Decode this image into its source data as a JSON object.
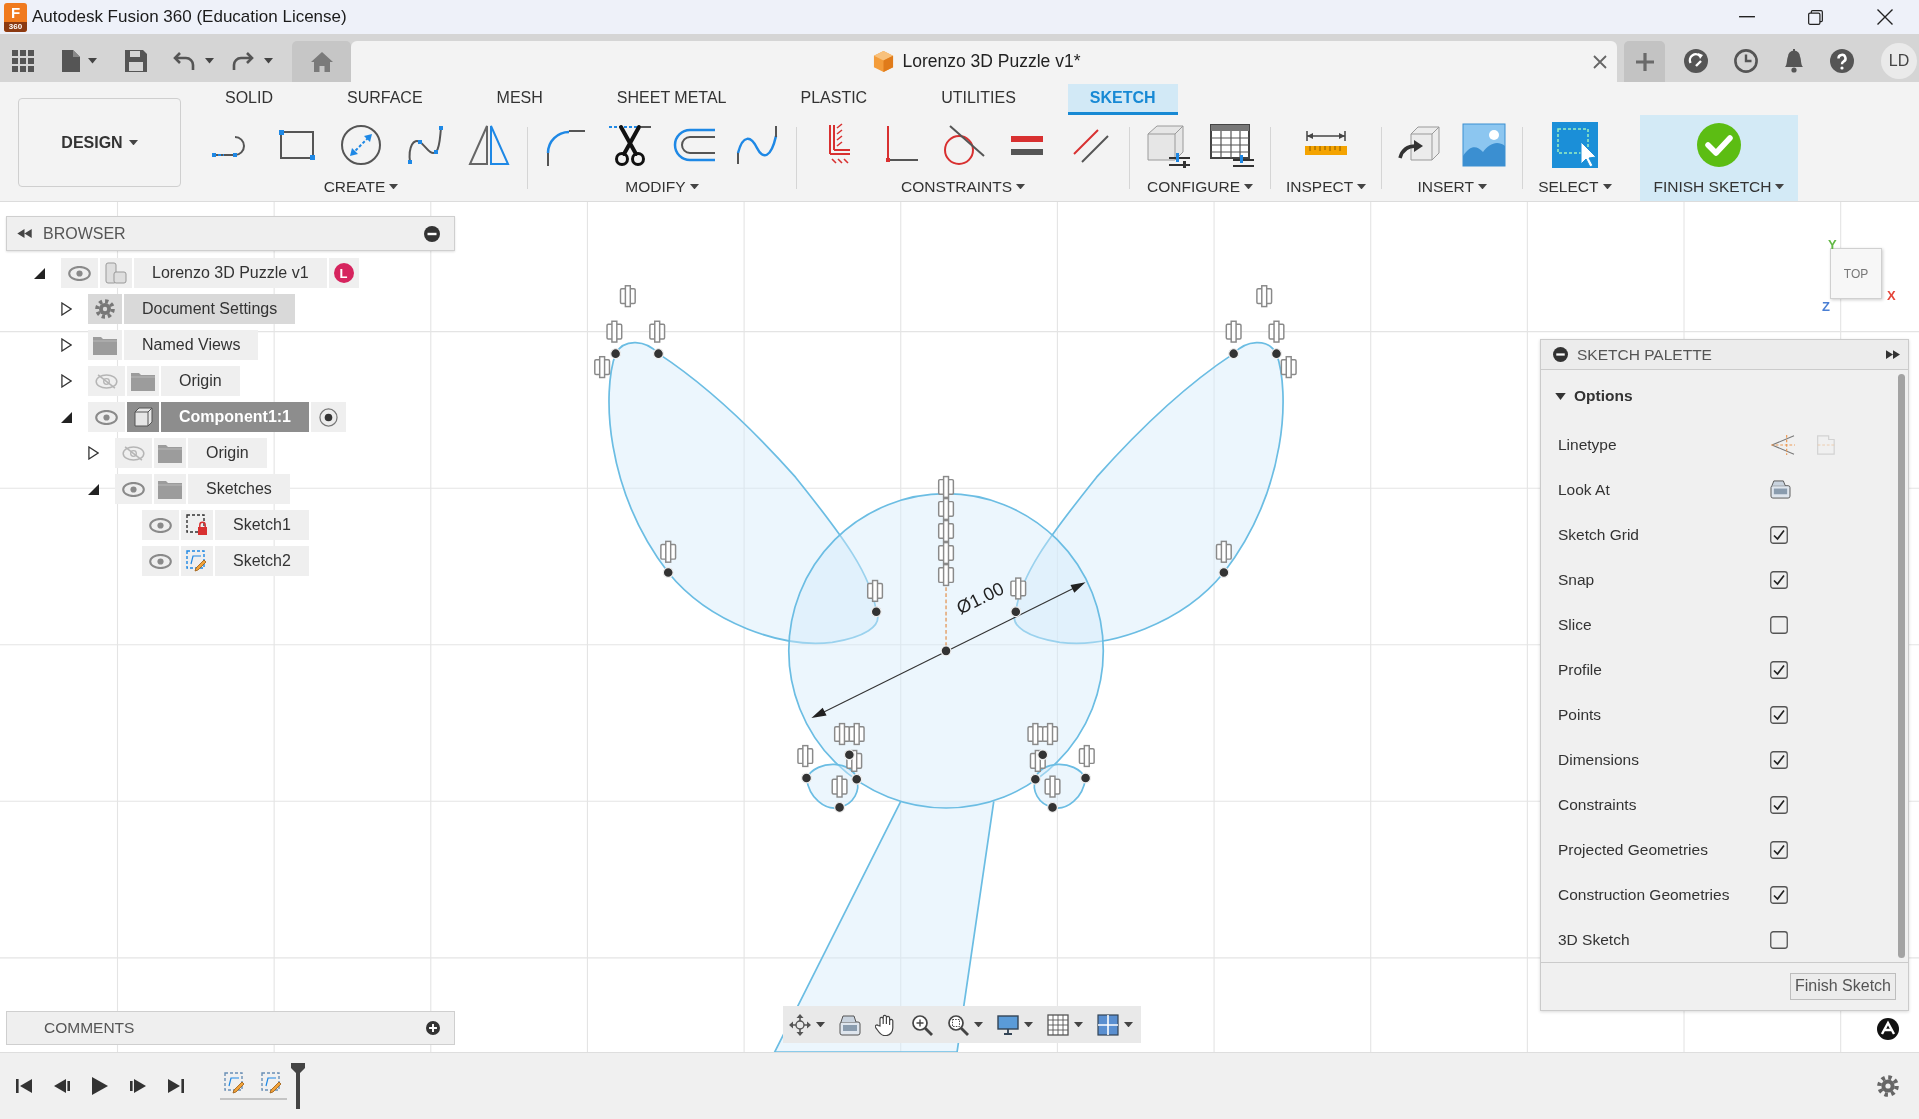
{
  "window": {
    "title": "Autodesk Fusion 360 (Education License)",
    "logo": {
      "letter": "F",
      "caption": "360"
    }
  },
  "document_tab": {
    "title": "Lorenzo 3D Puzzle v1*"
  },
  "account": {
    "initials": "LD"
  },
  "toolbar": {
    "workspace": "DESIGN",
    "tabs": [
      {
        "label": "SOLID",
        "selected": false
      },
      {
        "label": "SURFACE",
        "selected": false
      },
      {
        "label": "MESH",
        "selected": false
      },
      {
        "label": "SHEET METAL",
        "selected": false
      },
      {
        "label": "PLASTIC",
        "selected": false
      },
      {
        "label": "UTILITIES",
        "selected": false
      },
      {
        "label": "SKETCH",
        "selected": true
      }
    ],
    "groups": [
      {
        "label": "CREATE",
        "highlighted": false,
        "tools": [
          {
            "kind": "line"
          },
          {
            "kind": "rectangle"
          },
          {
            "kind": "circle"
          },
          {
            "kind": "spline"
          },
          {
            "kind": "mirror"
          }
        ]
      },
      {
        "label": "MODIFY",
        "highlighted": false,
        "tools": [
          {
            "kind": "fillet"
          },
          {
            "kind": "trim"
          },
          {
            "kind": "offset"
          },
          {
            "kind": "curve"
          }
        ]
      },
      {
        "label": "CONSTRAINTS",
        "highlighted": false,
        "tools": [
          {
            "kind": "fix"
          },
          {
            "kind": "perpendicular"
          },
          {
            "kind": "tangent"
          },
          {
            "kind": "equal"
          },
          {
            "kind": "parallel"
          }
        ]
      },
      {
        "label": "CONFIGURE",
        "highlighted": false,
        "tools": [
          {
            "kind": "parameter"
          },
          {
            "kind": "table"
          }
        ]
      },
      {
        "label": "INSPECT",
        "highlighted": false,
        "tools": [
          {
            "kind": "measure"
          }
        ]
      },
      {
        "label": "INSERT",
        "highlighted": false,
        "tools": [
          {
            "kind": "insert"
          },
          {
            "kind": "image"
          }
        ]
      },
      {
        "label": "SELECT",
        "highlighted": false,
        "tools": [
          {
            "kind": "select"
          }
        ]
      },
      {
        "label": "FINISH SKETCH",
        "highlighted": true,
        "tools": [
          {
            "kind": "finish"
          }
        ]
      }
    ]
  },
  "browser": {
    "title": "BROWSER",
    "tree": [
      {
        "label": "Lorenzo 3D Puzzle v1",
        "kind": "root",
        "visible": true,
        "expanded": true,
        "selected": false,
        "hovered": false,
        "badge": "L",
        "children": [
          {
            "label": "Document Settings",
            "kind": "settings",
            "expanded": false,
            "selected": false,
            "hovered": true
          },
          {
            "label": "Named Views",
            "kind": "folder",
            "expanded": false,
            "selected": false,
            "hovered": false
          },
          {
            "label": "Origin",
            "kind": "folder",
            "visible": false,
            "expanded": false,
            "selected": false,
            "hovered": false
          },
          {
            "label": "Component1:1",
            "kind": "component",
            "visible": true,
            "expanded": true,
            "selected": true,
            "hovered": false,
            "children": [
              {
                "label": "Origin",
                "kind": "folder",
                "visible": false,
                "expanded": false,
                "selected": false,
                "hovered": false
              },
              {
                "label": "Sketches",
                "kind": "folder",
                "visible": true,
                "expanded": true,
                "selected": false,
                "hovered": false,
                "children": [
                  {
                    "label": "Sketch1",
                    "kind": "sketch",
                    "editing": false,
                    "visible": true,
                    "selected": false,
                    "hovered": false
                  },
                  {
                    "label": "Sketch2",
                    "kind": "sketch",
                    "editing": true,
                    "visible": true,
                    "selected": false,
                    "hovered": false
                  }
                ]
              }
            ]
          }
        ]
      }
    ]
  },
  "canvas": {
    "dimension": "Ø1.00",
    "view_cube": {
      "face": "TOP",
      "axes": [
        {
          "label": "Y",
          "color": "#62b845"
        },
        {
          "label": "X",
          "color": "#e5463a"
        },
        {
          "label": "Z",
          "color": "#4a7fd4"
        }
      ]
    }
  },
  "sketch_palette": {
    "title": "SKETCH PALETTE",
    "section": {
      "title": "Options",
      "expanded": true
    },
    "options": [
      {
        "label": "Linetype",
        "kind": "linetype"
      },
      {
        "label": "Look At",
        "kind": "lookat"
      },
      {
        "label": "Sketch Grid",
        "kind": "checkbox",
        "checked": true
      },
      {
        "label": "Snap",
        "kind": "checkbox",
        "checked": true
      },
      {
        "label": "Slice",
        "kind": "checkbox",
        "checked": false
      },
      {
        "label": "Profile",
        "kind": "checkbox",
        "checked": true
      },
      {
        "label": "Points",
        "kind": "checkbox",
        "checked": true
      },
      {
        "label": "Dimensions",
        "kind": "checkbox",
        "checked": true
      },
      {
        "label": "Constraints",
        "kind": "checkbox",
        "checked": true
      },
      {
        "label": "Projected Geometries",
        "kind": "checkbox",
        "checked": true
      },
      {
        "label": "Construction Geometries",
        "kind": "checkbox",
        "checked": true
      },
      {
        "label": "3D Sketch",
        "kind": "checkbox",
        "checked": false
      }
    ],
    "button": "Finish Sketch"
  },
  "comments": {
    "title": "COMMENTS"
  },
  "navigation_bar": {
    "tools": [
      {
        "kind": "orbit",
        "menu": true
      },
      {
        "kind": "look",
        "menu": false
      },
      {
        "kind": "pan",
        "menu": false
      },
      {
        "kind": "zoom",
        "menu": false
      },
      {
        "kind": "fit",
        "menu": true
      },
      {
        "kind": "display",
        "menu": true
      },
      {
        "kind": "grid",
        "menu": true
      },
      {
        "kind": "viewports",
        "menu": true
      }
    ]
  },
  "timeline": {
    "items": [
      {
        "kind": "sketch"
      },
      {
        "kind": "sketch"
      }
    ]
  }
}
